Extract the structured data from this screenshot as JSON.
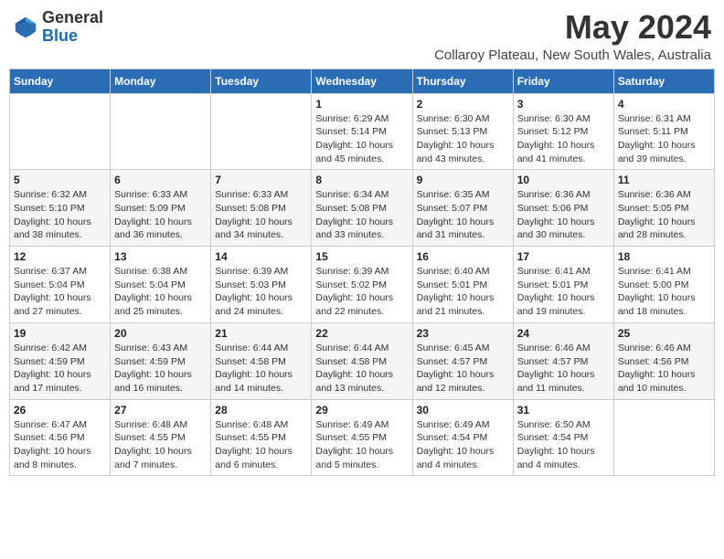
{
  "logo": {
    "general": "General",
    "blue": "Blue"
  },
  "title": {
    "month_year": "May 2024",
    "location": "Collaroy Plateau, New South Wales, Australia"
  },
  "weekdays": [
    "Sunday",
    "Monday",
    "Tuesday",
    "Wednesday",
    "Thursday",
    "Friday",
    "Saturday"
  ],
  "weeks": [
    [
      {
        "day": "",
        "sunrise": "",
        "sunset": "",
        "daylight": ""
      },
      {
        "day": "",
        "sunrise": "",
        "sunset": "",
        "daylight": ""
      },
      {
        "day": "",
        "sunrise": "",
        "sunset": "",
        "daylight": ""
      },
      {
        "day": "1",
        "sunrise": "Sunrise: 6:29 AM",
        "sunset": "Sunset: 5:14 PM",
        "daylight": "Daylight: 10 hours and 45 minutes."
      },
      {
        "day": "2",
        "sunrise": "Sunrise: 6:30 AM",
        "sunset": "Sunset: 5:13 PM",
        "daylight": "Daylight: 10 hours and 43 minutes."
      },
      {
        "day": "3",
        "sunrise": "Sunrise: 6:30 AM",
        "sunset": "Sunset: 5:12 PM",
        "daylight": "Daylight: 10 hours and 41 minutes."
      },
      {
        "day": "4",
        "sunrise": "Sunrise: 6:31 AM",
        "sunset": "Sunset: 5:11 PM",
        "daylight": "Daylight: 10 hours and 39 minutes."
      }
    ],
    [
      {
        "day": "5",
        "sunrise": "Sunrise: 6:32 AM",
        "sunset": "Sunset: 5:10 PM",
        "daylight": "Daylight: 10 hours and 38 minutes."
      },
      {
        "day": "6",
        "sunrise": "Sunrise: 6:33 AM",
        "sunset": "Sunset: 5:09 PM",
        "daylight": "Daylight: 10 hours and 36 minutes."
      },
      {
        "day": "7",
        "sunrise": "Sunrise: 6:33 AM",
        "sunset": "Sunset: 5:08 PM",
        "daylight": "Daylight: 10 hours and 34 minutes."
      },
      {
        "day": "8",
        "sunrise": "Sunrise: 6:34 AM",
        "sunset": "Sunset: 5:08 PM",
        "daylight": "Daylight: 10 hours and 33 minutes."
      },
      {
        "day": "9",
        "sunrise": "Sunrise: 6:35 AM",
        "sunset": "Sunset: 5:07 PM",
        "daylight": "Daylight: 10 hours and 31 minutes."
      },
      {
        "day": "10",
        "sunrise": "Sunrise: 6:36 AM",
        "sunset": "Sunset: 5:06 PM",
        "daylight": "Daylight: 10 hours and 30 minutes."
      },
      {
        "day": "11",
        "sunrise": "Sunrise: 6:36 AM",
        "sunset": "Sunset: 5:05 PM",
        "daylight": "Daylight: 10 hours and 28 minutes."
      }
    ],
    [
      {
        "day": "12",
        "sunrise": "Sunrise: 6:37 AM",
        "sunset": "Sunset: 5:04 PM",
        "daylight": "Daylight: 10 hours and 27 minutes."
      },
      {
        "day": "13",
        "sunrise": "Sunrise: 6:38 AM",
        "sunset": "Sunset: 5:04 PM",
        "daylight": "Daylight: 10 hours and 25 minutes."
      },
      {
        "day": "14",
        "sunrise": "Sunrise: 6:39 AM",
        "sunset": "Sunset: 5:03 PM",
        "daylight": "Daylight: 10 hours and 24 minutes."
      },
      {
        "day": "15",
        "sunrise": "Sunrise: 6:39 AM",
        "sunset": "Sunset: 5:02 PM",
        "daylight": "Daylight: 10 hours and 22 minutes."
      },
      {
        "day": "16",
        "sunrise": "Sunrise: 6:40 AM",
        "sunset": "Sunset: 5:01 PM",
        "daylight": "Daylight: 10 hours and 21 minutes."
      },
      {
        "day": "17",
        "sunrise": "Sunrise: 6:41 AM",
        "sunset": "Sunset: 5:01 PM",
        "daylight": "Daylight: 10 hours and 19 minutes."
      },
      {
        "day": "18",
        "sunrise": "Sunrise: 6:41 AM",
        "sunset": "Sunset: 5:00 PM",
        "daylight": "Daylight: 10 hours and 18 minutes."
      }
    ],
    [
      {
        "day": "19",
        "sunrise": "Sunrise: 6:42 AM",
        "sunset": "Sunset: 4:59 PM",
        "daylight": "Daylight: 10 hours and 17 minutes."
      },
      {
        "day": "20",
        "sunrise": "Sunrise: 6:43 AM",
        "sunset": "Sunset: 4:59 PM",
        "daylight": "Daylight: 10 hours and 16 minutes."
      },
      {
        "day": "21",
        "sunrise": "Sunrise: 6:44 AM",
        "sunset": "Sunset: 4:58 PM",
        "daylight": "Daylight: 10 hours and 14 minutes."
      },
      {
        "day": "22",
        "sunrise": "Sunrise: 6:44 AM",
        "sunset": "Sunset: 4:58 PM",
        "daylight": "Daylight: 10 hours and 13 minutes."
      },
      {
        "day": "23",
        "sunrise": "Sunrise: 6:45 AM",
        "sunset": "Sunset: 4:57 PM",
        "daylight": "Daylight: 10 hours and 12 minutes."
      },
      {
        "day": "24",
        "sunrise": "Sunrise: 6:46 AM",
        "sunset": "Sunset: 4:57 PM",
        "daylight": "Daylight: 10 hours and 11 minutes."
      },
      {
        "day": "25",
        "sunrise": "Sunrise: 6:46 AM",
        "sunset": "Sunset: 4:56 PM",
        "daylight": "Daylight: 10 hours and 10 minutes."
      }
    ],
    [
      {
        "day": "26",
        "sunrise": "Sunrise: 6:47 AM",
        "sunset": "Sunset: 4:56 PM",
        "daylight": "Daylight: 10 hours and 8 minutes."
      },
      {
        "day": "27",
        "sunrise": "Sunrise: 6:48 AM",
        "sunset": "Sunset: 4:55 PM",
        "daylight": "Daylight: 10 hours and 7 minutes."
      },
      {
        "day": "28",
        "sunrise": "Sunrise: 6:48 AM",
        "sunset": "Sunset: 4:55 PM",
        "daylight": "Daylight: 10 hours and 6 minutes."
      },
      {
        "day": "29",
        "sunrise": "Sunrise: 6:49 AM",
        "sunset": "Sunset: 4:55 PM",
        "daylight": "Daylight: 10 hours and 5 minutes."
      },
      {
        "day": "30",
        "sunrise": "Sunrise: 6:49 AM",
        "sunset": "Sunset: 4:54 PM",
        "daylight": "Daylight: 10 hours and 4 minutes."
      },
      {
        "day": "31",
        "sunrise": "Sunrise: 6:50 AM",
        "sunset": "Sunset: 4:54 PM",
        "daylight": "Daylight: 10 hours and 4 minutes."
      },
      {
        "day": "",
        "sunrise": "",
        "sunset": "",
        "daylight": ""
      }
    ]
  ]
}
